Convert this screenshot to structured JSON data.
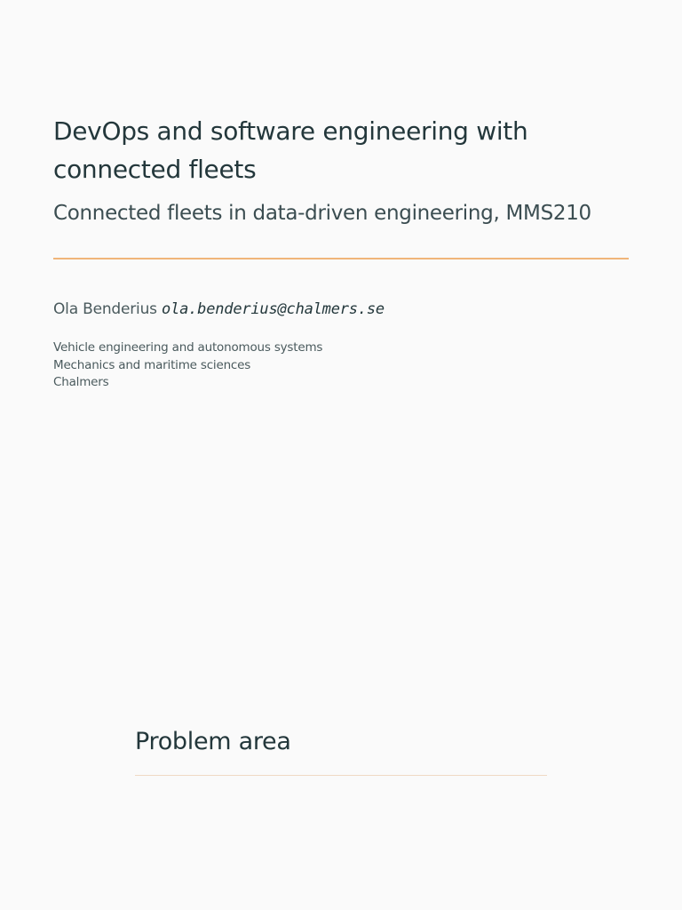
{
  "title_slide": {
    "title": "DevOps and software engineering with connected fleets",
    "subtitle": "Connected fleets in data-driven engineering, MMS210",
    "author": "Ola Benderius",
    "email": "ola.benderius@chalmers.se",
    "institute": [
      "Vehicle engineering and autonomous systems",
      "Mechanics and maritime sciences",
      "Chalmers"
    ]
  },
  "next_slide": {
    "frame_title": "Problem area"
  },
  "colors": {
    "background": "#fafafa",
    "text": "#23373b",
    "accent_rule": "#f0b57a"
  }
}
